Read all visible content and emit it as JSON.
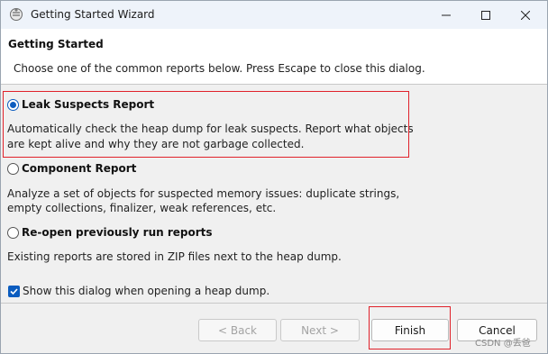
{
  "window": {
    "title": "Getting Started Wizard",
    "icon": "eclipse-mat-icon"
  },
  "header": {
    "title": "Getting Started",
    "description": "Choose one of the common reports below. Press Escape to close this dialog."
  },
  "options": [
    {
      "label": "Leak Suspects Report",
      "description_line1": "Automatically check the heap dump for leak suspects. Report what objects",
      "description_line2": "are kept alive and why they are not garbage collected.",
      "selected": true
    },
    {
      "label": "Component Report",
      "description_line1": "Analyze a set of objects for suspected memory issues: duplicate strings,",
      "description_line2": "empty collections, finalizer, weak references, etc.",
      "selected": false
    },
    {
      "label": "Re-open previously run reports",
      "description_line1": "Existing reports are stored in ZIP files next to the heap dump.",
      "selected": false
    }
  ],
  "checkbox": {
    "label": "Show this dialog when opening a heap dump.",
    "checked": true
  },
  "buttons": {
    "back": "< Back",
    "next": "Next >",
    "finish": "Finish",
    "cancel": "Cancel"
  },
  "watermark": "CSDN @丢爸",
  "colors": {
    "accent": "#0b5cbf",
    "highlight": "#e0212a"
  }
}
